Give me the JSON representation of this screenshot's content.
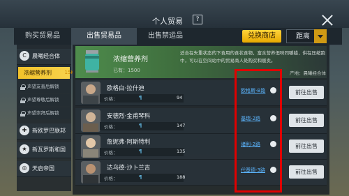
{
  "header": {
    "title": "个人贸易",
    "help_label": "?"
  },
  "tabs": [
    {
      "label": "购买贸易品",
      "active": false
    },
    {
      "label": "出售贸易品",
      "active": true
    },
    {
      "label": "出售禁运品",
      "active": false
    }
  ],
  "toolbar": {
    "exchange_label": "兑换商店",
    "distance_label": "距离"
  },
  "sidebar": {
    "group1": {
      "label": "晨曦经合体",
      "icon": "C"
    },
    "selected": {
      "label": "浓缩营养剂",
      "qty": "15K"
    },
    "locked": [
      "声望友善后解锁",
      "声望尊敬后解锁",
      "声望崇拜后解锁"
    ],
    "groups": [
      {
        "label": "新欧罗巴联邦",
        "icon": "✚"
      },
      {
        "label": "新瓦罗斯和国",
        "icon": "★"
      },
      {
        "label": "天启帝国",
        "icon": "◎"
      }
    ]
  },
  "product": {
    "name": "浓缩营养剂",
    "owned": "已有：1500",
    "description": "适合在失重状态的下食用的食状食物，富含营养但味同嚼蜡，供在压缩跑中，可以在空间站中的贸易商人处购买和贩卖。",
    "producer": "产地：晨曦经合体"
  },
  "rows": [
    {
      "name": "欧格白·拉什迪",
      "price_label": "价格：",
      "price": "94",
      "location": "欧格斯-B路",
      "action": "前往出售"
    },
    {
      "name": "安德烈·金甫琴科",
      "price_label": "价格：",
      "price": "147",
      "location": "基瑞-2路",
      "action": "前往出售"
    },
    {
      "name": "詹妮弗·阿斯特利",
      "price_label": "价格：",
      "price": "135",
      "location": "诸利-2路",
      "action": "前往出售"
    },
    {
      "name": "达乌德·沙卜兰吉",
      "price_label": "价格：",
      "price": "188",
      "location": "代基德-3路",
      "action": "前往出售"
    }
  ],
  "colors": {
    "accent": "#f3c22a",
    "highlight_box": "#e00000",
    "link": "#5cb6ff"
  }
}
